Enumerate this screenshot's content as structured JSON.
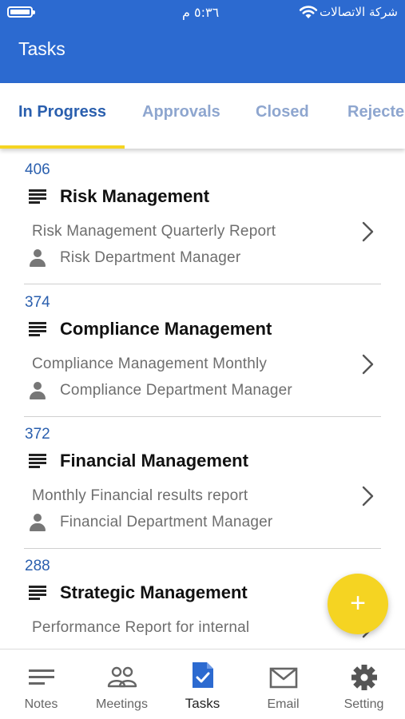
{
  "status_bar": {
    "time": "٥:٣٦ م",
    "carrier": "شركة الاتصالات"
  },
  "header": {
    "title": "Tasks"
  },
  "tabs": [
    {
      "label": "In Progress",
      "active": true
    },
    {
      "label": "Approvals",
      "active": false
    },
    {
      "label": "Closed",
      "active": false
    },
    {
      "label": "Rejected",
      "active": false
    }
  ],
  "tasks": [
    {
      "id": "406",
      "title": "Risk Management",
      "description": "Risk Management Quarterly Report",
      "owner": "Risk Department Manager"
    },
    {
      "id": "374",
      "title": "Compliance Management",
      "description": "Compliance Management Monthly",
      "owner": "Compliance Department Manager"
    },
    {
      "id": "372",
      "title": "Financial Management",
      "description": "Monthly Financial results report",
      "owner": "Financial Department Manager"
    },
    {
      "id": "288",
      "title": "Strategic Management",
      "description": "Performance Report for internal",
      "owner": ""
    }
  ],
  "fab": {
    "label": "+",
    "icon": "plus-icon"
  },
  "bottom_nav": [
    {
      "label": "Notes",
      "icon": "notes-icon",
      "active": false
    },
    {
      "label": "Meetings",
      "icon": "meetings-icon",
      "active": false
    },
    {
      "label": "Tasks",
      "icon": "tasks-icon",
      "active": true
    },
    {
      "label": "Email",
      "icon": "email-icon",
      "active": false
    },
    {
      "label": "Setting",
      "icon": "gear-icon",
      "active": false
    }
  ],
  "colors": {
    "header": "#2c6ad0",
    "active_tab": "#2a5fae",
    "inactive_tab": "#8ea6cf",
    "accent": "#f5d422",
    "task_id": "#2a5fae",
    "active_nav_icon": "#2c6ad0"
  }
}
